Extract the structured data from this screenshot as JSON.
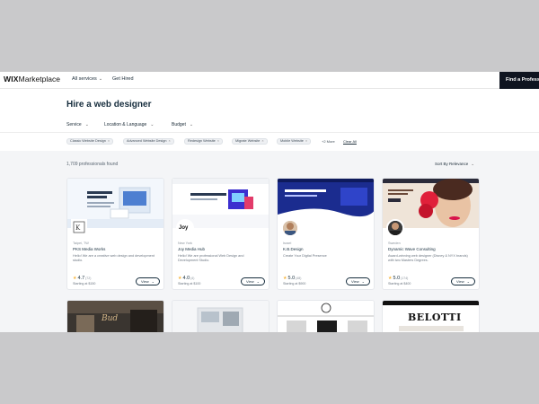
{
  "nav": {
    "logo_brand": "WIX",
    "logo_rest": "Marketplace",
    "all_services": "All services",
    "get_hired": "Get Hired",
    "find_pro": "Find a Professional"
  },
  "header": {
    "title": "Hire a web designer",
    "filters": [
      "Service",
      "Location & Language",
      "Budget"
    ]
  },
  "chips": [
    "Classic Website Design",
    "Advanced Website Design",
    "Redesign Website",
    "Migrate Website",
    "Mobile Website"
  ],
  "more_label": "+2 More",
  "clear_label": "Clear All",
  "results_count": "1,709 professionals found",
  "sort_label": "Sort By Relevance",
  "cards": [
    {
      "location": "Taipei, TW",
      "name": "PKS Media Works",
      "desc": "Hello! We are a creative web design and development studio.",
      "rating": "4.7",
      "reviews": "(72)",
      "price": "Starting at $150",
      "view": "View"
    },
    {
      "location": "New York",
      "name": "Joy Media Hub",
      "desc": "Hello! We are professional Web Design and Development Studio.",
      "rating": "4.0",
      "reviews": "(4)",
      "price": "Starting at $100",
      "view": "View"
    },
    {
      "location": "Israel",
      "name": "K.B.Design",
      "desc": "Create Your Digital Presence",
      "rating": "5.0",
      "reviews": "(48)",
      "price": "Starting at $900",
      "view": "View"
    },
    {
      "location": "Sweden",
      "name": "Dynamic Wave Consulting",
      "desc": "Award-winning web designer (Disney & NYX brands) with two Masters Degrees.",
      "rating": "5.0",
      "reviews": "(174)",
      "price": "Starting at $400",
      "view": "View"
    }
  ],
  "thumb_texts": {
    "card2_logo": "Joy",
    "card2_headline": "JOY Media Hub",
    "card3_headline": "Building My Wix Website (Hot Register)",
    "row2_card4_brand": "BELOTTI"
  },
  "colors": {
    "accent_dark": "#0f1420",
    "star": "#f6b53c",
    "card3_banner": "#1b2c8f"
  }
}
